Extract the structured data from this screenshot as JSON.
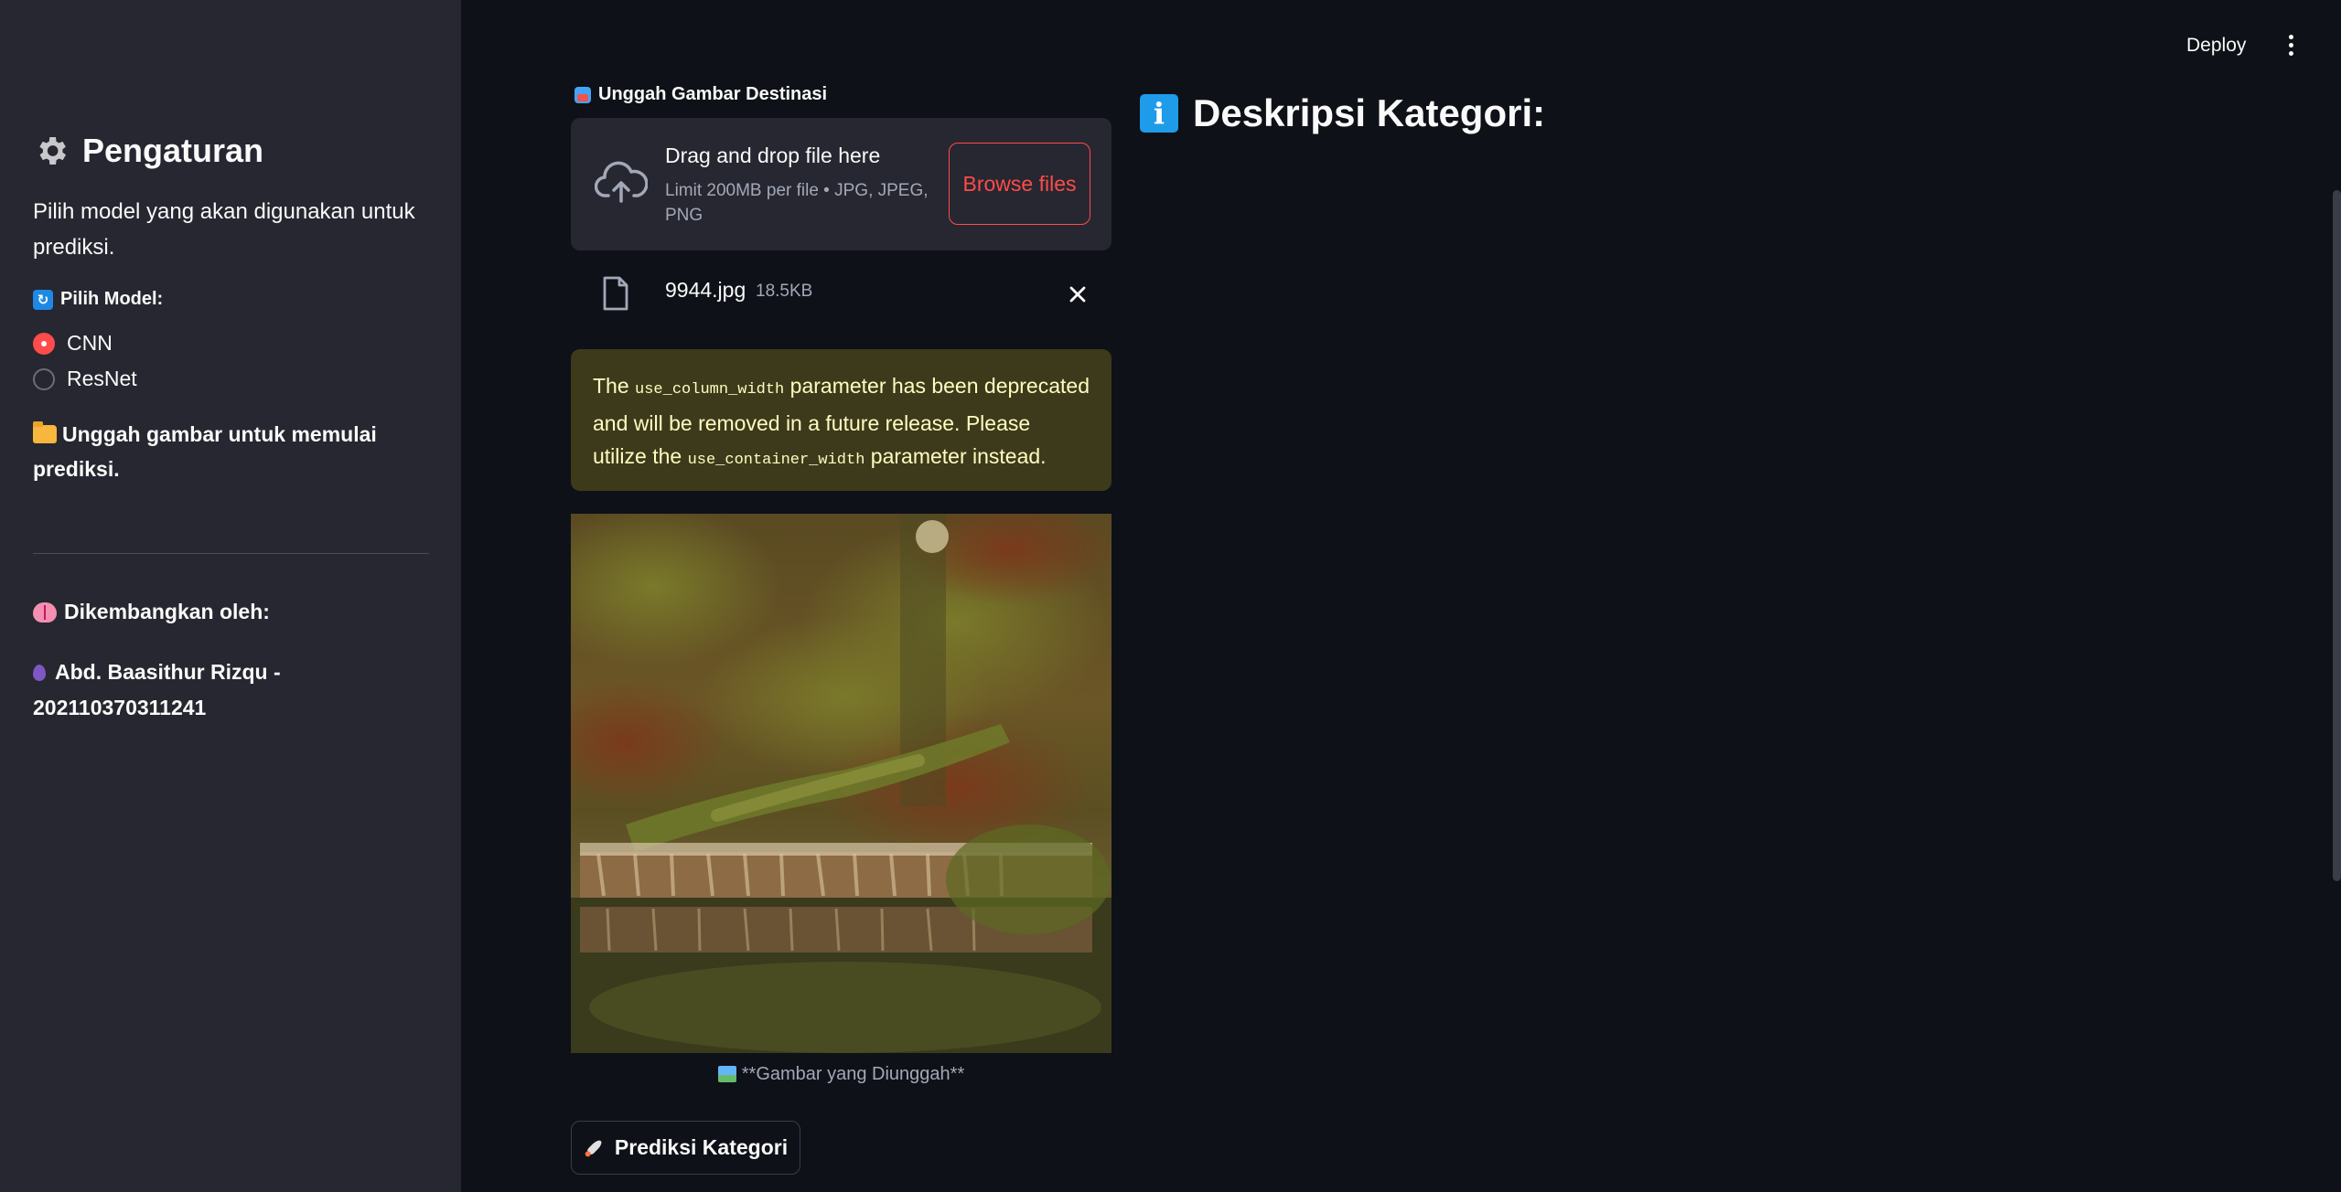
{
  "sidebar": {
    "title": "Pengaturan",
    "description": "Pilih model yang akan digunakan untuk prediksi.",
    "model_label": "Pilih Model:",
    "models": [
      {
        "label": "CNN",
        "selected": true
      },
      {
        "label": "ResNet",
        "selected": false
      }
    ],
    "upload_hint": "Unggah gambar untuk memulai prediksi.",
    "developed_by": "Dikembangkan oleh:",
    "author": "Abd. Baasithur Rizqu - 202110370311241"
  },
  "header": {
    "deploy_label": "Deploy"
  },
  "uploader": {
    "label": "Unggah Gambar Destinasi",
    "drag_text": "Drag and drop file here",
    "limit_text": "Limit 200MB per file • JPG, JPEG, PNG",
    "browse_label": "Browse files",
    "file_name": "9944.jpg",
    "file_size": "18.5KB"
  },
  "warning": {
    "prefix": "The ",
    "code1": "use_column_width",
    "middle": " parameter has been deprecated and will be removed in a future release. Please utilize the ",
    "code2": "use_container_width",
    "suffix": " parameter instead."
  },
  "image": {
    "caption": "**Gambar yang Diunggah**"
  },
  "predict_button": "Prediksi Kategori",
  "right": {
    "heading": "Deskripsi Kategori:"
  },
  "colors": {
    "accent": "#ff4b4b",
    "background": "#0e1117",
    "sidebar": "#262730",
    "warning_bg": "#3d3a1b",
    "warning_text": "#fffcc2",
    "info_icon": "#1e9be9"
  },
  "icons": [
    "gear-icon",
    "refresh-icon",
    "folder-icon",
    "brain-icon",
    "balloon-icon",
    "camera-icon",
    "cloud-upload-icon",
    "file-icon",
    "close-icon",
    "picture-icon",
    "rocket-icon",
    "info-icon",
    "kebab-menu-icon"
  ]
}
